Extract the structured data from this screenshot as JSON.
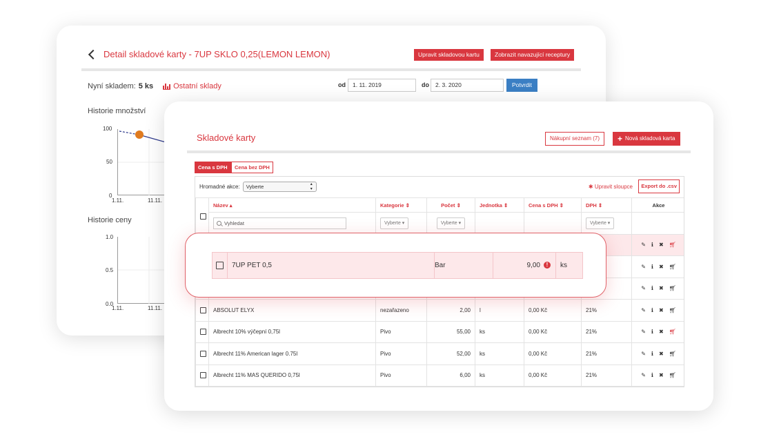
{
  "detail": {
    "title": "Detail skladové karty - 7UP SKLO 0,25(LEMON LEMON)",
    "btn_edit": "Upravit skladovou kartu",
    "btn_recipes": "Zobrazit navazující receptury",
    "stock_label": "Nyní skladem:",
    "stock_value": "5 ks",
    "other_stores": "Ostatní sklady",
    "from_label": "od",
    "from_value": "1. 11. 2019",
    "to_label": "do",
    "to_value": "2. 3. 2020",
    "confirm": "Potvrdit",
    "qty_history": "Historie množství",
    "qty_ticks": [
      "100",
      "50",
      "0"
    ],
    "qty_x_ticks": [
      "1.11.",
      "11.11."
    ],
    "price_history": "Historie ceny",
    "price_ticks": [
      "1.0",
      "0.5",
      "0.0"
    ],
    "price_x_ticks": [
      "1.11.",
      "11.11."
    ],
    "marker_color": "#e07b1f",
    "line_color": "#2e3a8c"
  },
  "cards": {
    "title": "Skladové karty",
    "shopping_list": "Nákupní seznam (7)",
    "new_card": "Nová skladová karta",
    "tabs": [
      "Cena s DPH",
      "Cena bez DPH"
    ],
    "bulk_label": "Hromadné akce:",
    "bulk_select": "Vyberte",
    "edit_columns": "Upravit sloupce",
    "export": "Export do .csv",
    "headers": {
      "name": "Název ▴",
      "category": "Kategorie ⇕",
      "count": "Počet ⇕",
      "unit": "Jednotka ⇕",
      "price": "Cena s DPH ⇕",
      "vat": "DPH ⇕",
      "actions": "Akce"
    },
    "filters": {
      "search_placeholder": "Vyhledat",
      "select": "Vyberte ▾"
    },
    "rows": [
      {
        "name": "ABSOLUT ELYX",
        "category": "nezařazeno",
        "count": "2,00",
        "unit": "l",
        "price": "0,00 Kč",
        "vat": "21%"
      },
      {
        "name": "Albrecht 10% výčepní 0,75l",
        "category": "Pivo",
        "count": "55,00",
        "unit": "ks",
        "price": "0,00 Kč",
        "vat": "21%"
      },
      {
        "name": "Albrecht 11% American lager 0.75l",
        "category": "Pivo",
        "count": "52,00",
        "unit": "ks",
        "price": "0,00 Kč",
        "vat": "21%"
      },
      {
        "name": "Albrecht 11% MAS QUERIDO 0,75l",
        "category": "Pivo",
        "count": "6,00",
        "unit": "ks",
        "price": "0,00 Kč",
        "vat": "21%"
      }
    ],
    "highlight": {
      "name": "7UP PET 0,5",
      "category": "Bar",
      "count": "9,00",
      "unit": "ks"
    },
    "accent": "#d9373f"
  }
}
